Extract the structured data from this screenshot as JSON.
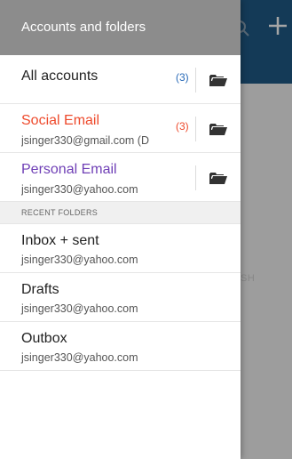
{
  "app": {
    "peek_text": "SH"
  },
  "drawer": {
    "title": "Accounts and folders",
    "accounts": [
      {
        "name": "All accounts",
        "email": "",
        "count": "(3)",
        "name_color": "#222222",
        "count_color": "#2a6bb8",
        "has_folder_icon": true
      },
      {
        "name": "Social Email",
        "email": "jsinger330@gmail.com (D",
        "count": "(3)",
        "name_color": "#ee4a2c",
        "count_color": "#ee4a2c",
        "has_folder_icon": true
      },
      {
        "name": "Personal Email",
        "email": "jsinger330@yahoo.com",
        "count": "",
        "name_color": "#6f3fb6",
        "count_color": "#6f3fb6",
        "has_folder_icon": true
      }
    ],
    "recent_header": "RECENT FOLDERS",
    "recent_folders": [
      {
        "name": "Inbox + sent",
        "email": "jsinger330@yahoo.com"
      },
      {
        "name": "Drafts",
        "email": "jsinger330@yahoo.com"
      },
      {
        "name": "Outbox",
        "email": "jsinger330@yahoo.com"
      }
    ]
  },
  "colors": {
    "drawer_header_bg": "#8c8c8c",
    "app_topbar_bg": "#1f5a86",
    "folder_icon": "#333333"
  }
}
